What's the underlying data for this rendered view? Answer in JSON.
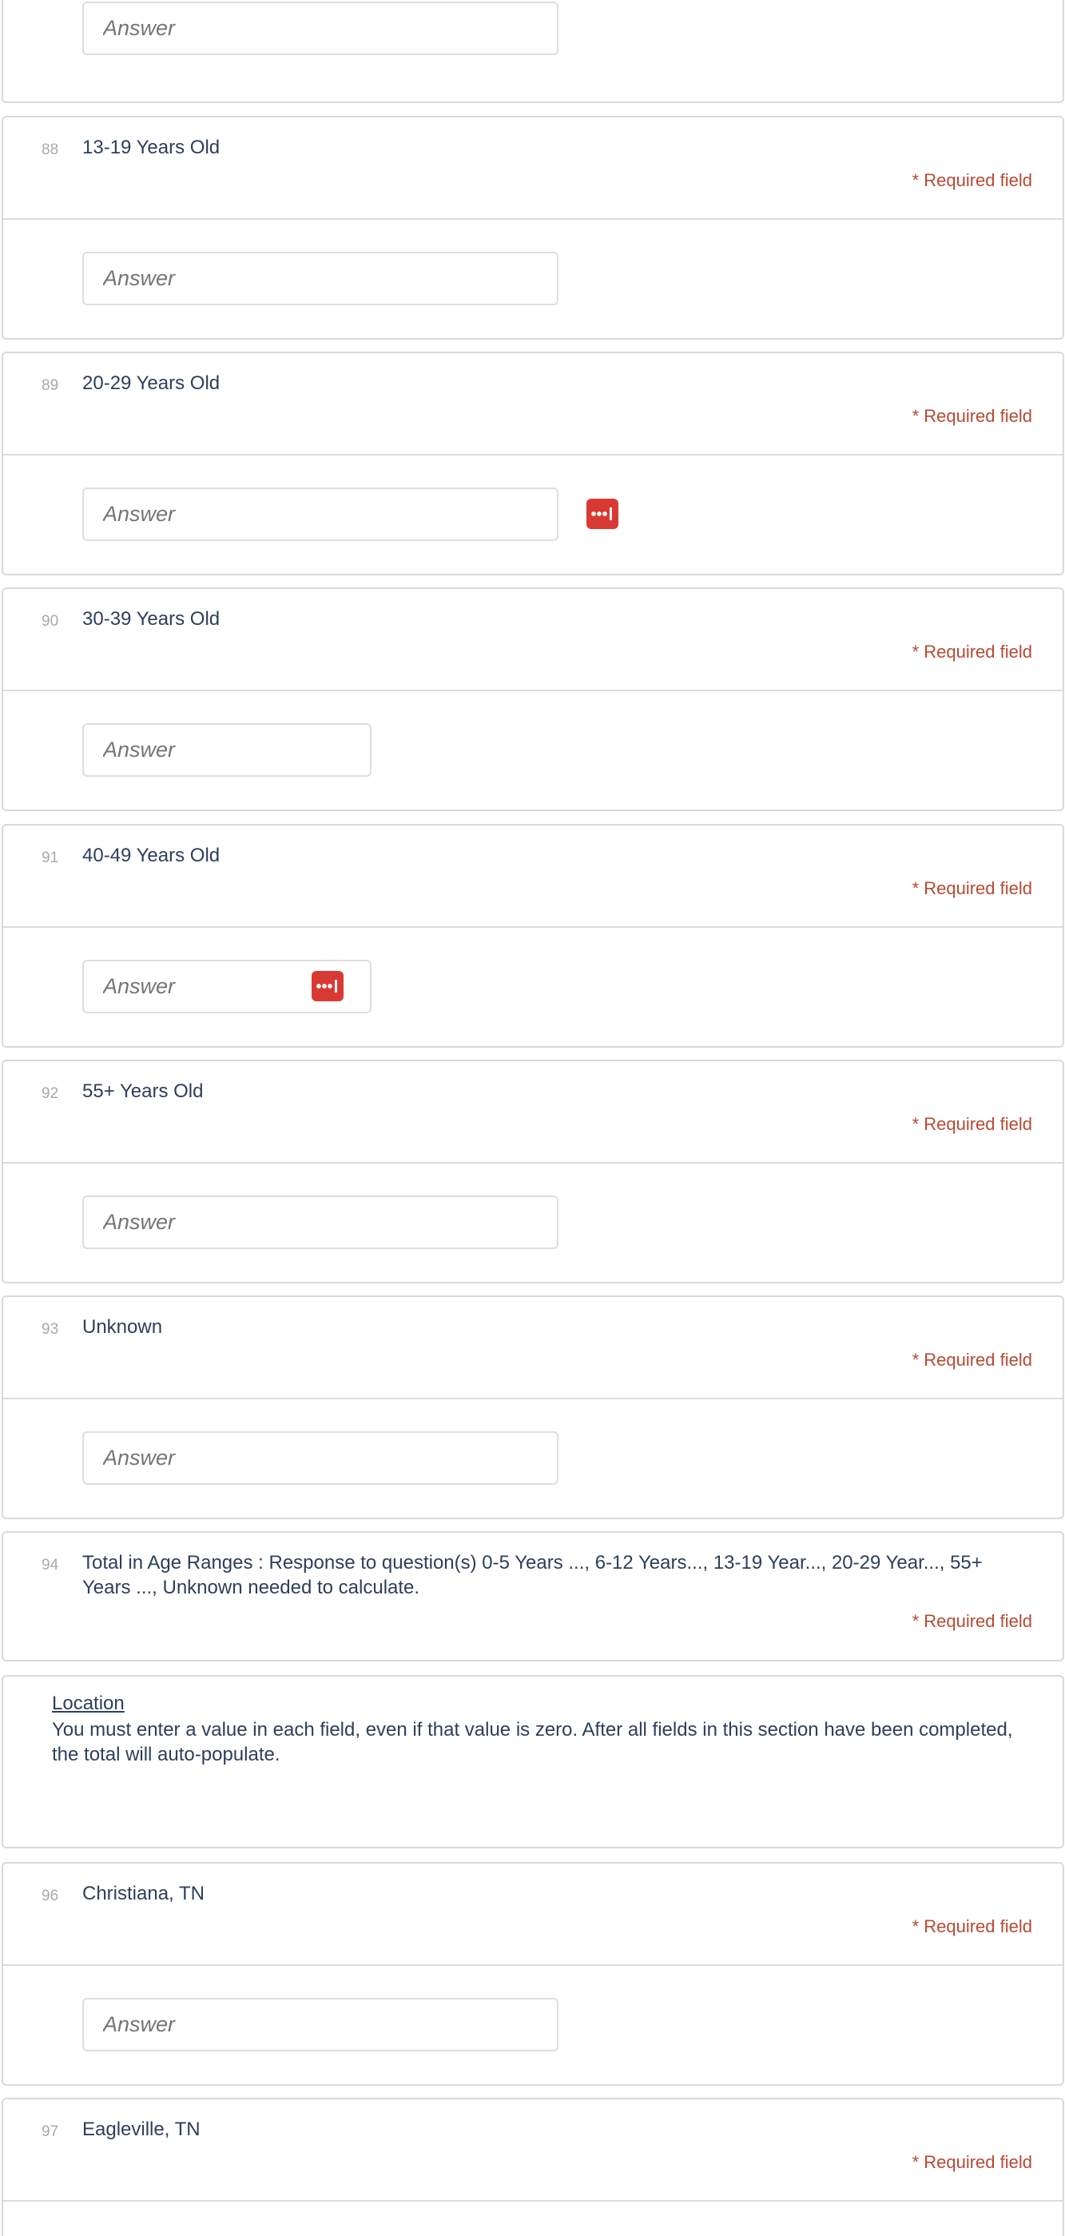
{
  "answer_placeholder": "Answer",
  "required_label": "* Required field",
  "questions": {
    "q88": {
      "number": "88",
      "label": "13-19 Years Old"
    },
    "q89": {
      "number": "89",
      "label": "20-29 Years Old"
    },
    "q90": {
      "number": "90",
      "label": "30-39 Years Old"
    },
    "q91": {
      "number": "91",
      "label": "40-49 Years Old"
    },
    "q92": {
      "number": "92",
      "label": "55+ Years Old"
    },
    "q93": {
      "number": "93",
      "label": "Unknown"
    },
    "q94": {
      "number": "94",
      "label": "Total in Age Ranges : Response to question(s) 0-5 Years ..., 6-12 Years..., 13-19 Year..., 20-29 Year..., 55+ Years ..., Unknown needed to calculate."
    },
    "q96": {
      "number": "96",
      "label": "Christiana, TN"
    },
    "q97": {
      "number": "97",
      "label": "Eagleville, TN"
    }
  },
  "location_section": {
    "title": "Location",
    "text": "You must enter a value in each field, even if that value is zero. After all fields in this section have been completed, the total will auto-populate."
  },
  "colors": {
    "required": "#b64a33",
    "password_manager_icon": "#d83a33",
    "text": "#2d3f5a"
  }
}
